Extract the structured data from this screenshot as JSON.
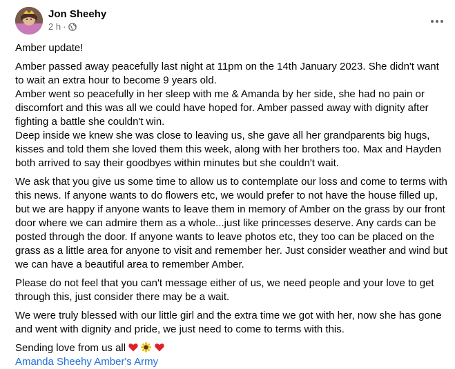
{
  "post": {
    "author": "Jon Sheehy",
    "time": "2 h",
    "separator": "·",
    "lines": {
      "l1": "Amber update!",
      "l2": "Amber passed away peacefully last night at 11pm on the 14th January 2023. She didn't want to wait an extra hour to become 9 years old.",
      "l3": "Amber went so peacefully in her sleep with me & Amanda by her side, she had no pain or discomfort and this was all we could have hoped for. Amber passed away with dignity after fighting a battle she couldn't win.",
      "l4": "Deep inside we knew she was close to leaving us, she gave all her grandparents big hugs, kisses and told them she loved them this week, along with her brothers too. Max and Hayden both arrived to say their goodbyes within minutes but she couldn't wait.",
      "p2": "We ask that you give us some time to allow us to contemplate our loss and come to terms with this news. If anyone wants to do flowers etc, we would prefer to not have the house filled up, but we are happy if anyone wants to leave them in memory of Amber on the grass by our front door where we can admire them as a whole...just like princesses deserve. Any cards can be posted through the door. If anyone wants to leave photos etc, they too can be placed on the grass as a little area for anyone to visit and remember her. Just consider weather and wind but we can have a beautiful area to remember Amber.",
      "p3": "Please do not feel that you can't message either of us, we need people and your love to get through this, just consider there may be a wait.",
      "p4": "We were truly blessed with our little girl and the extra time we got with her, now she has gone and went with dignity and pride, we just need to come to terms with this.",
      "closing": "Sending love from us all "
    },
    "tags": [
      "Amanda Sheehy",
      "Amber's Army"
    ],
    "icons": {
      "privacy": "globe-icon",
      "menu": "more-options-icon",
      "emoji": [
        "red-heart-emoji",
        "sunflower-emoji",
        "red-heart-emoji"
      ]
    },
    "colors": {
      "link": "#216fdb",
      "secondary": "#65676b",
      "heart": "#e0202a"
    }
  }
}
